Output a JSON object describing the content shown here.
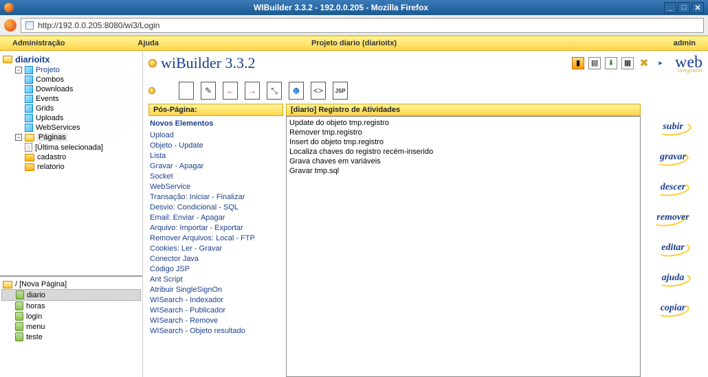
{
  "window": {
    "title": "WIBuilder 3.3.2 - 192.0.0.205 - Mozilla Firefox"
  },
  "url": "http://192.0.0.205:8080/wi3/Login",
  "menubar": {
    "admin": "Administração",
    "help": "Ajuda",
    "project": "Projeto diario (diarioitx)",
    "user": "admin"
  },
  "tree": {
    "root": "diarioitx",
    "project": "Projeto",
    "project_items": [
      "Combos",
      "Downloads",
      "Events",
      "Grids",
      "Uploads",
      "WebServices"
    ],
    "pages": "Páginas",
    "pages_items": [
      "[Última selecionada]",
      "cadastro",
      "relatorio"
    ]
  },
  "lower_tree": {
    "root": "/ [Nova Página]",
    "items": [
      "diario",
      "horas",
      "login",
      "menu",
      "teste"
    ],
    "selected": "diario"
  },
  "app_title": "wiBuilder 3.3.2",
  "logo": "web",
  "logo_sub": "integrator",
  "panel_left_head": "Pós-Página:",
  "panel_mid_head": "[diario] Registro de Atividades",
  "elements_group": "Novos Elementos",
  "elements": [
    "Upload",
    "Objeto - Update",
    "Lista",
    "Gravar - Apagar",
    "Socket",
    "WebService",
    "Transação: Iniciar - Finalizar",
    "Desvio: Condicional - SQL",
    "Email: Enviar - Apagar",
    "Arquivo: Importar - Exportar",
    "Remover Arquivos: Local - FTP",
    "Cookies: Ler - Gravar",
    "Conector Java",
    "Código JSP",
    "Ant Script",
    "Atribuir SingleSignOn",
    "WISearch - Indexador",
    "WISearch - Publicador",
    "WISearch - Remove",
    "WISearch - Objeto resultado"
  ],
  "activities": [
    "Update do objeto tmp.registro",
    "Remover tmp.registro",
    "Insert do objeto tmp.registro",
    "Localiza chaves do registro recém-inserido",
    "Grava chaves em variáveis",
    "Gravar tmp.sql"
  ],
  "actions": [
    "subir",
    "gravar",
    "descer",
    "remover",
    "editar",
    "ajuda",
    "copiar"
  ]
}
